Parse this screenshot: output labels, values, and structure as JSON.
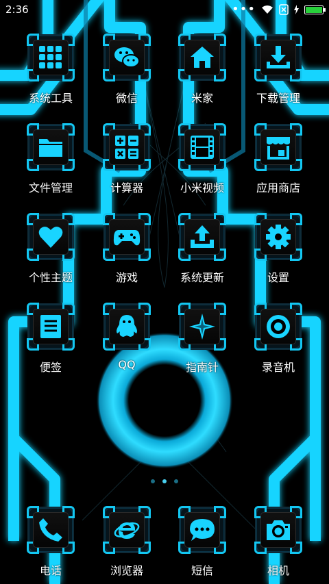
{
  "status_bar": {
    "time": "2:36",
    "more": "•••"
  },
  "apps": [
    {
      "label": "系统工具",
      "icon": "folder-grid-icon"
    },
    {
      "label": "微信",
      "icon": "chat-bubbles-icon"
    },
    {
      "label": "米家",
      "icon": "home-icon"
    },
    {
      "label": "下载管理",
      "icon": "download-icon"
    },
    {
      "label": "文件管理",
      "icon": "folder-icon"
    },
    {
      "label": "计算器",
      "icon": "calculator-icon"
    },
    {
      "label": "小米视频",
      "icon": "film-icon"
    },
    {
      "label": "应用商店",
      "icon": "store-icon"
    },
    {
      "label": "个性主题",
      "icon": "heart-icon"
    },
    {
      "label": "游戏",
      "icon": "gamepad-icon"
    },
    {
      "label": "系统更新",
      "icon": "upload-icon"
    },
    {
      "label": "设置",
      "icon": "gear-icon"
    },
    {
      "label": "便签",
      "icon": "notes-icon"
    },
    {
      "label": "QQ",
      "icon": "penguin-icon"
    },
    {
      "label": "指南针",
      "icon": "compass-icon"
    },
    {
      "label": "录音机",
      "icon": "record-icon"
    }
  ],
  "dock": [
    {
      "label": "电话",
      "icon": "phone-icon"
    },
    {
      "label": "浏览器",
      "icon": "browser-icon"
    },
    {
      "label": "短信",
      "icon": "message-icon"
    },
    {
      "label": "相机",
      "icon": "camera-icon"
    }
  ],
  "pager": {
    "count": 3,
    "active_index": 1
  },
  "colors": {
    "accent": "#13c7f2",
    "glow": "#19d4ff",
    "background": "#000000",
    "battery": "#28d13b"
  }
}
